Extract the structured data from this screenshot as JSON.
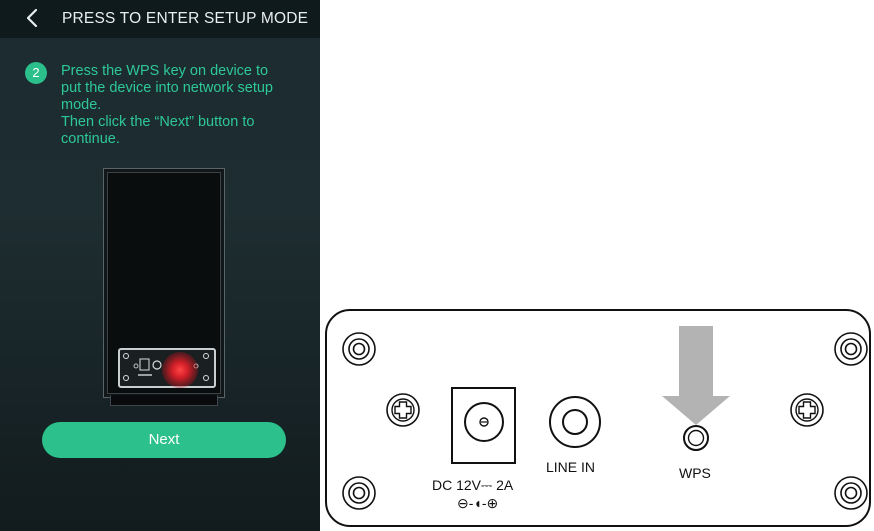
{
  "header": {
    "title": "PRESS TO ENTER SETUP MODE",
    "back_icon": "chevron-left-icon"
  },
  "step": {
    "number": "2",
    "lines": [
      "Press the WPS key on device to",
      "put the device into network setup",
      "mode.",
      "Then click the “Next” button to",
      "continue."
    ]
  },
  "actions": {
    "next_label": "Next"
  },
  "device_panel": {
    "power_label": "DC 12V⎓ 2A",
    "polarity_symbol": "⊖-◖-⊕",
    "line_in_label": "LINE IN",
    "wps_label": "WPS",
    "arrow_icon": "down-arrow-icon"
  },
  "colors": {
    "accent": "#2cc08d",
    "instruction_text": "#2ec898",
    "screen_bg": "#1e2d31",
    "highlight": "#e63030"
  }
}
